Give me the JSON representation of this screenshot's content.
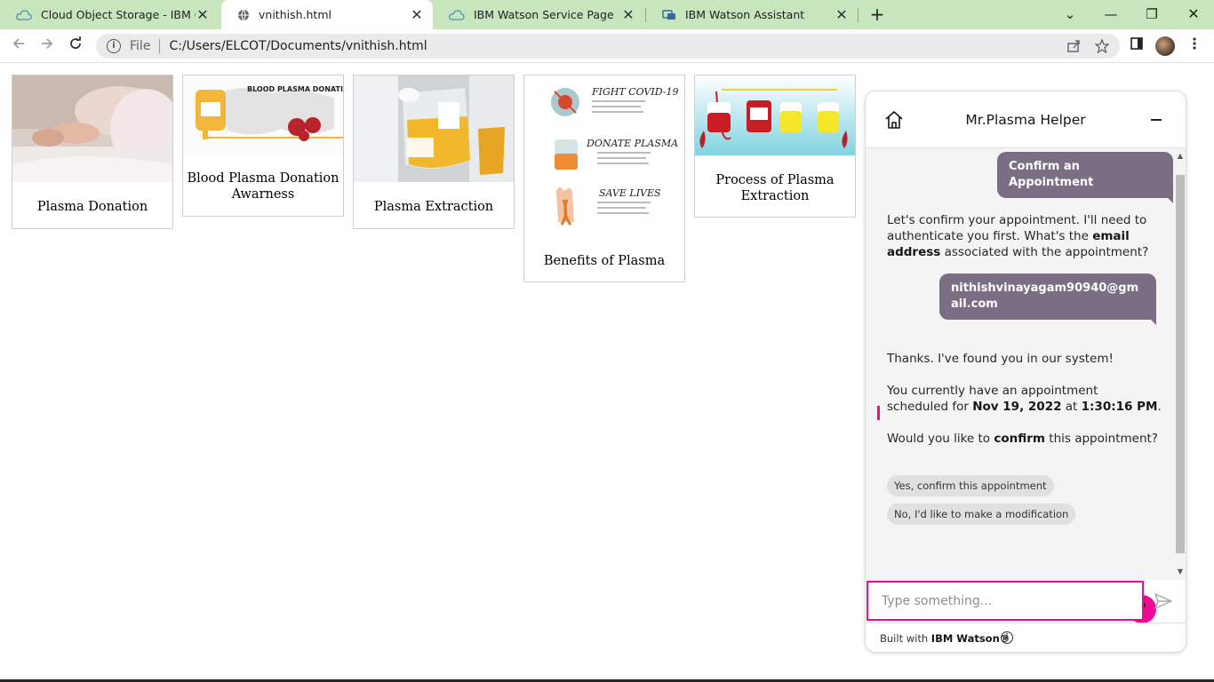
{
  "browser": {
    "tabs": [
      {
        "title": "Cloud Object Storage - IBM Clou",
        "icon": "cloud-icon",
        "active": false
      },
      {
        "title": "vnithish.html",
        "icon": "globe-icon",
        "active": true
      },
      {
        "title": "IBM Watson Service Page",
        "icon": "cloud-icon",
        "active": false
      },
      {
        "title": "IBM Watson Assistant",
        "icon": "assistant-icon",
        "active": false
      }
    ],
    "close_glyph": "✕",
    "new_tab_glyph": "+",
    "window": {
      "dropdown": "⌄",
      "minimize": "—",
      "restore": "❐",
      "close": "✕"
    },
    "address": {
      "scheme_label": "File",
      "url": "C:/Users/ELCOT/Documents/vnithish.html"
    },
    "colors": {
      "tab_strip": "#c8e6bd"
    }
  },
  "cards": [
    {
      "caption": "Plasma Donation",
      "image": "patient-photo"
    },
    {
      "caption": "Blood Plasma Donation Awarness",
      "image": "plasma-donation-banner",
      "image_title": "BLOOD PLASMA DONATION"
    },
    {
      "caption": "Plasma Extraction",
      "image": "plasma-bag-photo"
    },
    {
      "caption": "Benefits of Plasma",
      "image": "covid-infographic",
      "items": [
        "FIGHT COVID-19",
        "DONATE PLASMA",
        "SAVE LIVES"
      ]
    },
    {
      "caption": "Process of Plasma Extraction",
      "image": "blood-bags-illustration"
    }
  ],
  "chat": {
    "title": "Mr.Plasma Helper",
    "messages": {
      "user_confirm": "Confirm an Appointment",
      "bot_auth_1": "Let's confirm your appointment. I'll need to authenticate you first. What's the ",
      "bot_auth_bold": "email address",
      "bot_auth_2": " associated with the appointment?",
      "user_email": "nithishvinayagam90940@gmail.com",
      "bot_found": "Thanks. I've found you in our system!",
      "bot_sched_1": "You currently have an appointment scheduled for ",
      "bot_sched_date": "Nov 19, 2022",
      "bot_sched_at": " at ",
      "bot_sched_time": "1:30:16 PM",
      "bot_sched_end": ".",
      "bot_ask_1": "Would you like to ",
      "bot_ask_bold": "confirm",
      "bot_ask_2": " this appointment?"
    },
    "options": [
      "Yes, confirm this appointment",
      "No, I'd like to make a modification"
    ],
    "help_glyph": "?",
    "input_placeholder": "Type something...",
    "footer_prefix": "Built with ",
    "footer_brand": "IBM Watson®",
    "info_glyph": "i",
    "colors": {
      "accent": "#ee0a94",
      "user_bubble": "#7b6d84",
      "body_bg": "#f4f4f4"
    }
  }
}
